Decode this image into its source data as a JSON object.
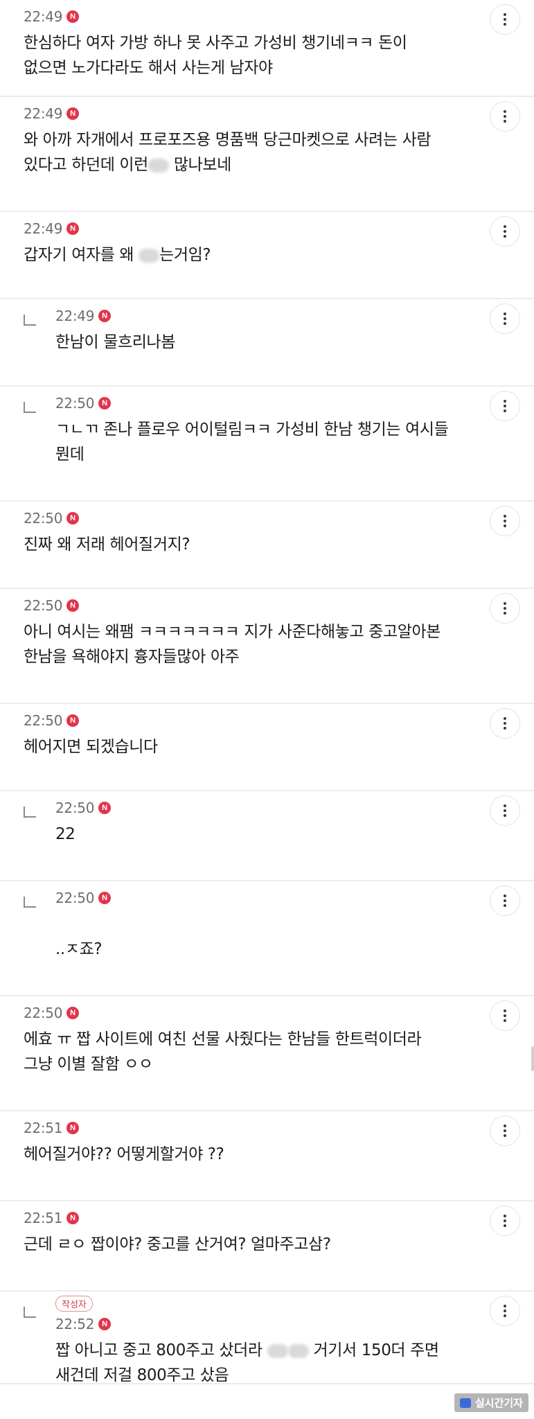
{
  "comments": [
    {
      "time": "22:49",
      "badge": "N",
      "text": "한심하다 여자 가방 하나 못 사주고 가성비 챙기네ㅋㅋ 돈이\n없으면 노가다라도 해서 사는게 남자야",
      "reply": false
    },
    {
      "time": "22:49",
      "badge": "N",
      "text": "와 아까 자개에서 프로포즈용 명품백 당근마켓으로 사려는 사람\n있다고 하던데 이런▒ 많나보네",
      "reply": false
    },
    {
      "time": "22:49",
      "badge": "N",
      "text": "갑자기 여자를 왜 ▒는거임?",
      "reply": false
    },
    {
      "time": "22:49",
      "badge": "N",
      "text": "한남이 물흐리나봄",
      "reply": true
    },
    {
      "time": "22:50",
      "badge": "N",
      "text": "ㄱㄴㄲ 존나 플로우 어이털림ㅋㅋ 가성비 한남 챙기는 여시들\n뭔데",
      "reply": true
    },
    {
      "time": "22:50",
      "badge": "N",
      "text": "진짜 왜 저래 헤어질거지?",
      "reply": false
    },
    {
      "time": "22:50",
      "badge": "N",
      "text": "아니 여시는 왜팸 ㅋㅋㅋㅋㅋㅋㅋ 지가 사준다해놓고 중고알아본\n한남을 욕해야지 흉자들많아 아주",
      "reply": false
    },
    {
      "time": "22:50",
      "badge": "N",
      "text": "헤어지면 되겠습니다",
      "reply": false
    },
    {
      "time": "22:50",
      "badge": "N",
      "text": "22",
      "reply": true
    },
    {
      "time": "22:50",
      "badge": "N",
      "text": "\n..ㅈ죠?",
      "reply": true
    },
    {
      "time": "22:50",
      "badge": "N",
      "text": "에효 ㅠ 짭 사이트에 여친 선물 사줬다는 한남들 한트럭이더라\n그냥 이별 잘함 ㅇㅇ",
      "reply": false
    },
    {
      "time": "22:51",
      "badge": "N",
      "text": "헤어질거야?? 어떻게할거야 ??",
      "reply": false
    },
    {
      "time": "22:51",
      "badge": "N",
      "text": "근데 ㄹㅇ 짭이야? 중고를 산거여? 얼마주고삼?",
      "reply": false
    },
    {
      "time": "22:52",
      "badge": "N",
      "author_label": "작성자",
      "text": "짭 아니고 중고 800주고 샀더라 ▒▒ 거기서 150더 주면\n새건데 저걸 800주고 샀음",
      "reply": true
    }
  ],
  "watermark": "실시간기자",
  "icons": {
    "more": "more-vertical-icon",
    "reply": "reply-arrow-icon",
    "new": "new-badge-icon"
  },
  "colors": {
    "badge": "#e0364a",
    "author_badge": "#d23a4a",
    "divider": "#ececec"
  }
}
